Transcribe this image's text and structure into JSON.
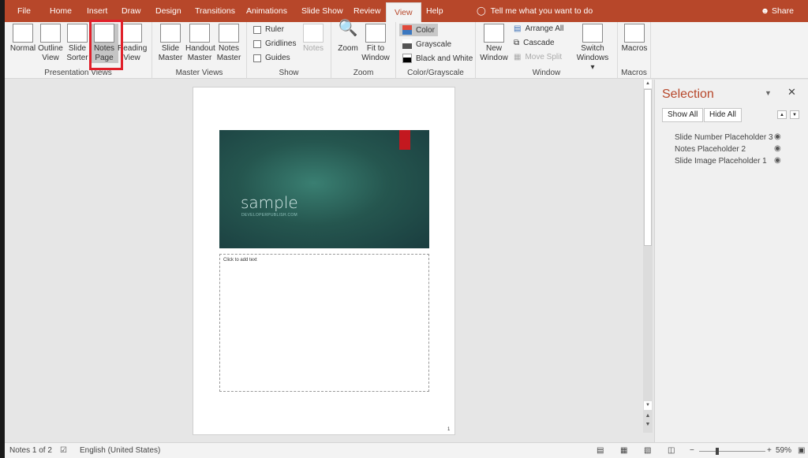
{
  "tabs": [
    "File",
    "Home",
    "Insert",
    "Draw",
    "Design",
    "Transitions",
    "Animations",
    "Slide Show",
    "Review",
    "View",
    "Help"
  ],
  "active_tab": "View",
  "tell_me": "Tell me what you want to do",
  "share": "Share",
  "ribbon": {
    "presentation_views": {
      "label": "Presentation Views",
      "buttons": [
        [
          "Normal",
          ""
        ],
        [
          "Outline",
          "View"
        ],
        [
          "Slide",
          "Sorter"
        ],
        [
          "Notes",
          "Page"
        ],
        [
          "Reading",
          "View"
        ]
      ]
    },
    "master_views": {
      "label": "Master Views",
      "buttons": [
        [
          "Slide",
          "Master"
        ],
        [
          "Handout",
          "Master"
        ],
        [
          "Notes",
          "Master"
        ]
      ]
    },
    "show": {
      "label": "Show",
      "checkboxes": [
        "Ruler",
        "Gridlines",
        "Guides"
      ],
      "notes": "Notes"
    },
    "zoom": {
      "label": "Zoom",
      "buttons": [
        [
          "Zoom",
          ""
        ],
        [
          "Fit to",
          "Window"
        ]
      ]
    },
    "color": {
      "label": "Color/Grayscale",
      "options": [
        "Color",
        "Grayscale",
        "Black and White"
      ],
      "colors": [
        "#e0493a",
        "#7a7a7a",
        "#000000"
      ]
    },
    "window": {
      "label": "Window",
      "new_window": [
        "New",
        "Window"
      ],
      "small": [
        "Arrange All",
        "Cascade",
        "Move Split"
      ],
      "switch": [
        "Switch",
        "Windows ▾"
      ]
    },
    "macros": {
      "label": "Macros",
      "button": "Macros"
    }
  },
  "slide": {
    "title": "sample",
    "subtitle": "DEVELOPERPUBLISH.COM"
  },
  "notes_placeholder": "Click to add text",
  "page_number": "1",
  "selection_pane": {
    "title": "Selection",
    "show_all": "Show All",
    "hide_all": "Hide All",
    "items": [
      "Slide Number Placeholder 3",
      "Notes Placeholder 2",
      "Slide Image Placeholder 1"
    ]
  },
  "status": {
    "page": "Notes 1 of 2",
    "language": "English (United States)",
    "zoom": "59%",
    "zoom_fraction": 0.59
  }
}
